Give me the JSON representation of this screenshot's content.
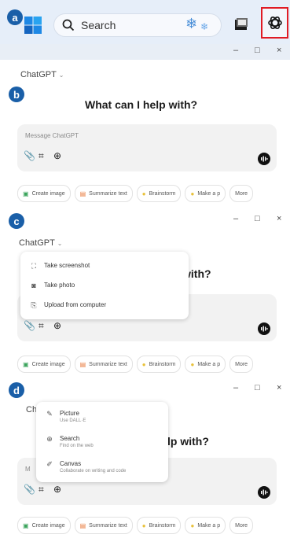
{
  "taskbar": {
    "search_label": "Search",
    "badge": "a"
  },
  "panel_b": {
    "badge": "b",
    "model": "ChatGPT",
    "heading": "What can I help with?",
    "placeholder": "Message ChatGPT",
    "controls": [
      "–",
      "□",
      "×"
    ]
  },
  "panel_c": {
    "badge": "c",
    "model": "ChatGPT",
    "heading_visible": "with?",
    "controls": [
      "–",
      "□",
      "×"
    ],
    "menu": [
      {
        "label": "Take screenshot",
        "icon": "screenshot-icon"
      },
      {
        "label": "Take photo",
        "icon": "camera-icon"
      },
      {
        "label": "Upload from computer",
        "icon": "upload-icon"
      }
    ]
  },
  "panel_d": {
    "badge": "d",
    "model_partial": "Ch",
    "heading_visible": "lp with?",
    "placeholder_partial": "M",
    "controls": [
      "–",
      "□",
      "×"
    ],
    "menu": [
      {
        "label": "Picture",
        "sub": "Use DALL·E",
        "icon": "picture-icon"
      },
      {
        "label": "Search",
        "sub": "Find on the web",
        "icon": "globe-icon"
      },
      {
        "label": "Canvas",
        "sub": "Collaborate on writing and code",
        "icon": "canvas-icon"
      }
    ]
  },
  "chips": [
    {
      "label": "Create image",
      "icon": "image-icon",
      "color": "#3aa35b"
    },
    {
      "label": "Summarize text",
      "icon": "document-icon",
      "color": "#e8793a"
    },
    {
      "label": "Brainstorm",
      "icon": "lightbulb-icon",
      "color": "#e8c13a"
    },
    {
      "label": "Make a p",
      "icon": "lightbulb-icon",
      "color": "#e8c13a"
    },
    {
      "label": "More",
      "icon": "",
      "color": "#555555"
    }
  ],
  "colors": {
    "badge": "#1a5fa8",
    "highlight": "#e01b24",
    "taskbar": "#e6eef9",
    "panel_bar": "#e8eef6"
  }
}
